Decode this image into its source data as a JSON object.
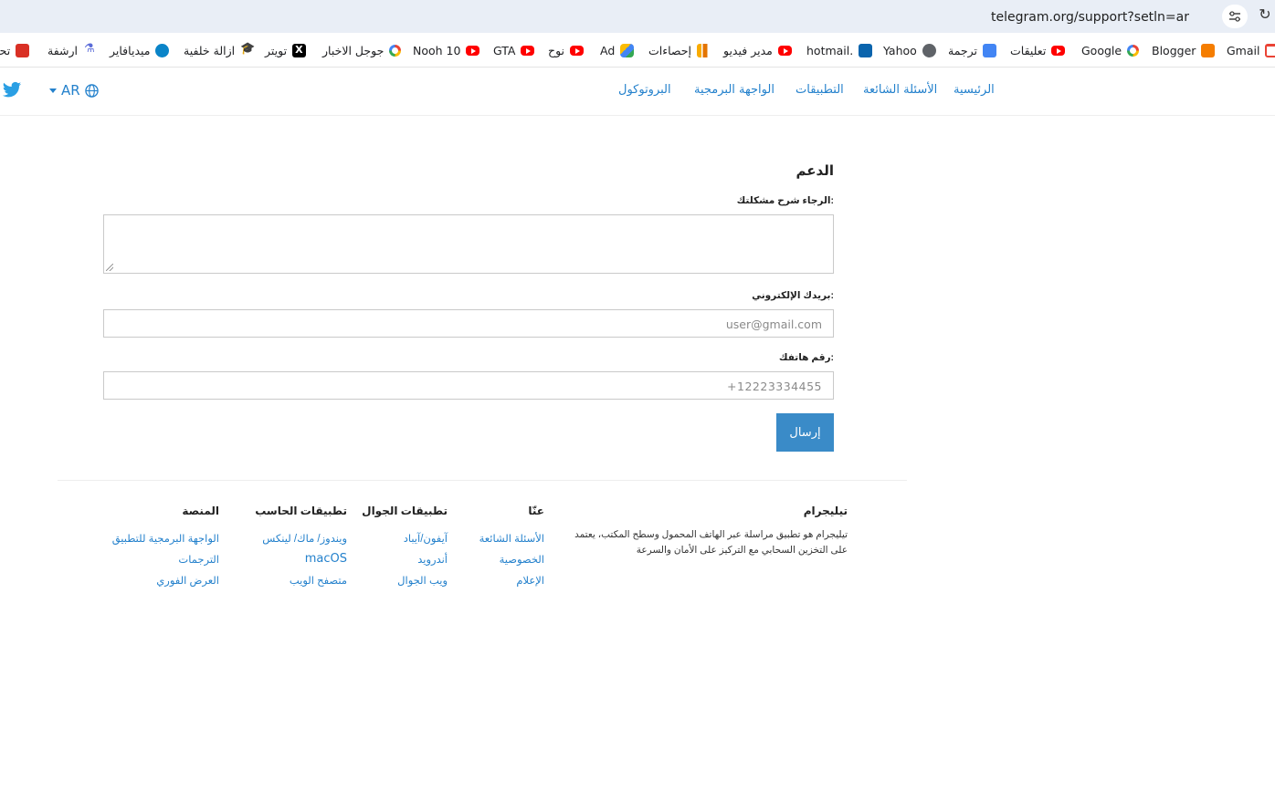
{
  "browser": {
    "url": "telegram.org/support?setln=ar",
    "bookmarks": [
      {
        "label": "Gmail",
        "icon": "gmail-icon"
      },
      {
        "label": "Blogger",
        "icon": "blogger-icon"
      },
      {
        "label": "Google",
        "icon": "google-icon"
      },
      {
        "label": "تعليقات",
        "icon": "youtube-icon"
      },
      {
        "label": "ترجمة",
        "icon": "translate-icon"
      },
      {
        "label": "Yahoo",
        "icon": "globe-icon"
      },
      {
        "label": "hotmail.",
        "icon": "outlook-icon"
      },
      {
        "label": "مدير فيديو",
        "icon": "youtube-icon"
      },
      {
        "label": "إحصاءات",
        "icon": "analytics-icon"
      },
      {
        "label": "Ad",
        "icon": "google-ads-icon"
      },
      {
        "label": "نوح",
        "icon": "youtube-icon"
      },
      {
        "label": "GTA",
        "icon": "youtube-icon"
      },
      {
        "label": "Nooh 10",
        "icon": "youtube-icon"
      },
      {
        "label": "جوجل الاخبار",
        "icon": "google-icon"
      },
      {
        "label": "تويتر",
        "icon": "x-icon"
      },
      {
        "label": "ازالة خلفية",
        "icon": "graduation-cap-icon"
      },
      {
        "label": "ميديافاير",
        "icon": "mediafire-icon"
      },
      {
        "label": "ارشفة",
        "icon": "archive-icon"
      },
      {
        "label": "تحـ",
        "icon": "qr-icon"
      }
    ]
  },
  "header": {
    "lang": "AR",
    "nav": [
      "الرئيسية",
      "الأسئلة الشائعة",
      "التطبيقات",
      "الواجهة البرمجية",
      "البروتوكول"
    ]
  },
  "form": {
    "title": "الدعم",
    "problem_label": "الرجاء شرح مشكلتك:",
    "email_label": "بريدك الإلكتروني:",
    "email_placeholder": "user@gmail.com",
    "phone_label": "رقم هاتفك:",
    "phone_placeholder": "+12223334455",
    "submit": "إرسال"
  },
  "footer": {
    "telegram": {
      "title": "تيليجرام",
      "desc": "تيليجرام هو تطبيق مراسلة عبر الهاتف المحمول وسطح المكتب، يعتمد على التخزين السحابي مع التركيز على الأمان والسرعة"
    },
    "about": {
      "title": "عنّا",
      "links": [
        "الأسئلة الشائعة",
        "الخصوصية",
        "الإعلام"
      ]
    },
    "mobile": {
      "title": "تطبيقات الجوال",
      "links": [
        "آيفون/آيباد",
        "أندرويد",
        "ويب الجوال"
      ]
    },
    "desktop": {
      "title": "تطبيقات الحاسب",
      "links": [
        "ويندوز/ ماك/ لينكس",
        "macOS",
        "متصفح الويب"
      ]
    },
    "platform": {
      "title": "المنصة",
      "links": [
        "الواجهة البرمجية للتطبيق",
        "الترجمات",
        "العرض الفوري"
      ]
    }
  },
  "colors": {
    "link": "#2481cc",
    "button": "#3a8bc8"
  }
}
